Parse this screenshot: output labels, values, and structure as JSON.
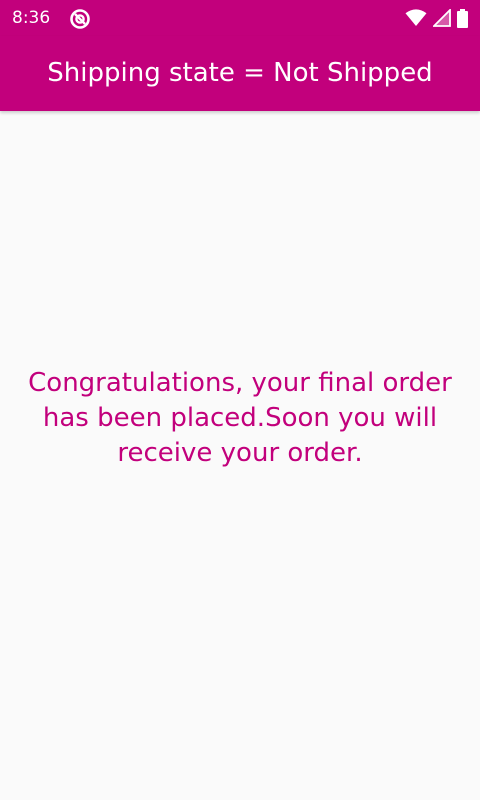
{
  "status_bar": {
    "time": "8:36",
    "icons": [
      "app-notification-icon",
      "wifi-icon",
      "cell-signal-icon",
      "battery-icon"
    ]
  },
  "app_bar": {
    "title": "Shipping state = Not Shipped"
  },
  "main": {
    "message": "Congratulations, your final order has been placed.Soon you will receive your order."
  },
  "colors": {
    "primary": "#c2007c",
    "background": "#fafafa",
    "on_primary": "#ffffff"
  }
}
